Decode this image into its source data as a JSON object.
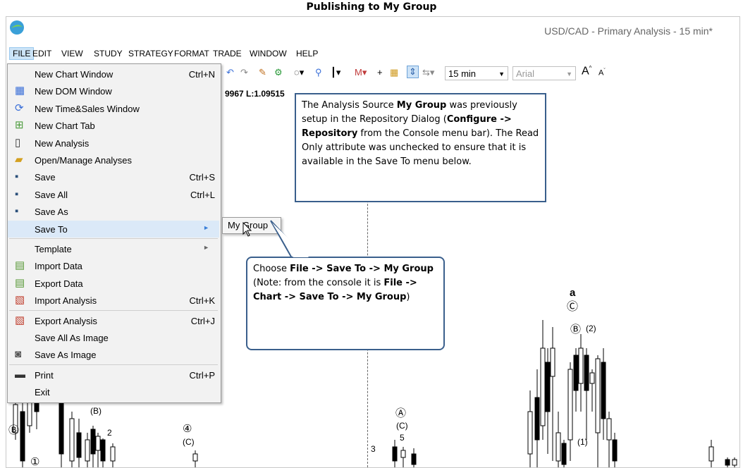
{
  "doc_title": "Publishing to My Group",
  "window": {
    "title": "USD/CAD - Primary Analysis - 15 min*"
  },
  "menubar": [
    "FILE",
    "EDIT",
    "VIEW",
    "STUDY",
    "STRATEGY",
    "FORMAT",
    "TRADE",
    "WINDOW",
    "HELP"
  ],
  "toolbar": {
    "interval": "15 min",
    "font": "Arial"
  },
  "ohlc_text": "9967  L:1.09515",
  "file_menu": [
    {
      "label": "New Chart Window",
      "shortcut": "Ctrl+N",
      "icon": "none"
    },
    {
      "label": "New DOM Window",
      "shortcut": "",
      "icon": "dom-window-icon"
    },
    {
      "label": "New Time&Sales Window",
      "shortcut": "",
      "icon": "time-sales-icon"
    },
    {
      "label": "New Chart Tab",
      "shortcut": "",
      "icon": "chart-tab-icon"
    },
    {
      "label": "New Analysis",
      "shortcut": "",
      "icon": "document-icon"
    },
    {
      "label": "Open/Manage Analyses",
      "shortcut": "",
      "icon": "folder-open-icon"
    },
    {
      "label": "Save",
      "shortcut": "Ctrl+S",
      "icon": "floppy-icon"
    },
    {
      "label": "Save All",
      "shortcut": "Ctrl+L",
      "icon": "floppy-multiple-icon"
    },
    {
      "label": "Save As",
      "shortcut": "",
      "icon": "floppy-as-icon"
    },
    {
      "label": "Save To",
      "shortcut": "",
      "icon": "none",
      "submenu": true
    },
    {
      "label": "Template",
      "shortcut": "",
      "icon": "none",
      "submenu": true
    },
    {
      "label": "Import Data",
      "shortcut": "",
      "icon": "import-data-icon"
    },
    {
      "label": "Export Data",
      "shortcut": "",
      "icon": "export-data-icon"
    },
    {
      "label": "Import Analysis",
      "shortcut": "Ctrl+K",
      "icon": "import-analysis-icon"
    },
    {
      "label": "Export Analysis",
      "shortcut": "Ctrl+J",
      "icon": "export-analysis-icon"
    },
    {
      "label": "Save All As Image",
      "shortcut": "",
      "icon": "none"
    },
    {
      "label": "Save As Image",
      "shortcut": "",
      "icon": "camera-icon"
    },
    {
      "label": "Print",
      "shortcut": "Ctrl+P",
      "icon": "printer-icon"
    },
    {
      "label": "Exit",
      "shortcut": "",
      "icon": "none"
    }
  ],
  "submenu_item": "My Group",
  "callout1": {
    "p1": "The Analysis Source ",
    "b1": "My Group",
    "p2": " was previously setup in the Repository Dialog (",
    "b2": "Configure -> Repository",
    "p3": " from the Console menu bar).  The Read Only attribute was unchecked to ensure that it is available in the Save To menu below."
  },
  "callout2": {
    "p1": "Choose ",
    "b1": "File -> Save To -> My Group",
    "p2": " (Note: from the console it is ",
    "b2": "File -> Chart -> Save To -> My Group",
    "p3": ")"
  },
  "wave_labels": [
    "a",
    "Ⓒ",
    "Ⓑ",
    "(2)",
    "(B)",
    "2",
    "④",
    "(C)",
    "Ⓐ",
    "(C)",
    "5",
    "3",
    "(1)",
    "Ⓑ",
    "①"
  ],
  "colors": {
    "accent": "#3a5f8c",
    "highlight": "#dbe9f8"
  }
}
